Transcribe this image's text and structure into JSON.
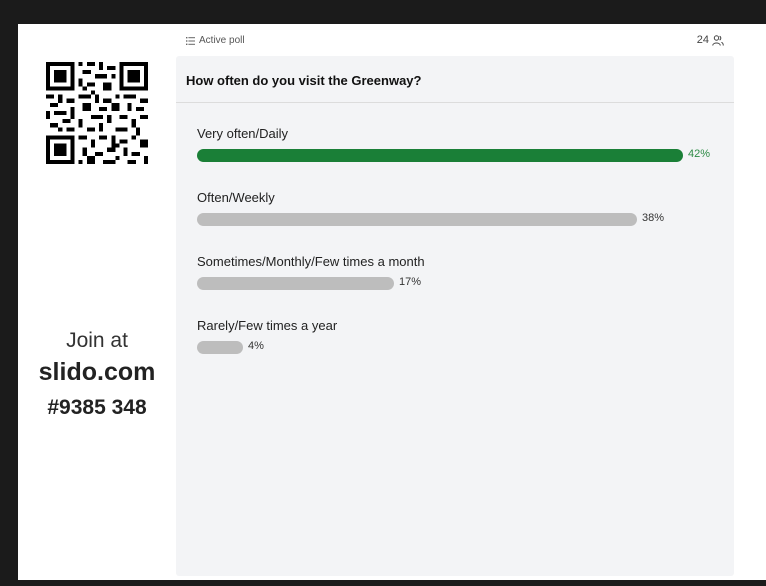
{
  "join": {
    "at_text": "Join at",
    "site": "slido.com",
    "code": "#9385 348"
  },
  "topbar": {
    "label": "Active poll",
    "participants": "24"
  },
  "poll": {
    "question": "How often do you visit the Greenway?",
    "options": [
      {
        "label": "Very often/Daily",
        "percent": 42,
        "percent_text": "42%",
        "winner": true
      },
      {
        "label": "Often/Weekly",
        "percent": 38,
        "percent_text": "38%",
        "winner": false
      },
      {
        "label": "Sometimes/Monthly/Few times a month",
        "percent": 17,
        "percent_text": "17%",
        "winner": false
      },
      {
        "label": "Rarely/Few times a year",
        "percent": 4,
        "percent_text": "4%",
        "winner": false
      }
    ]
  },
  "colors": {
    "winner_bar": "#1a7f37",
    "default_bar": "#bdbdbd",
    "card_bg": "#f3f4f6"
  },
  "icons": {
    "list": "list-icon",
    "participants": "people-icon"
  }
}
